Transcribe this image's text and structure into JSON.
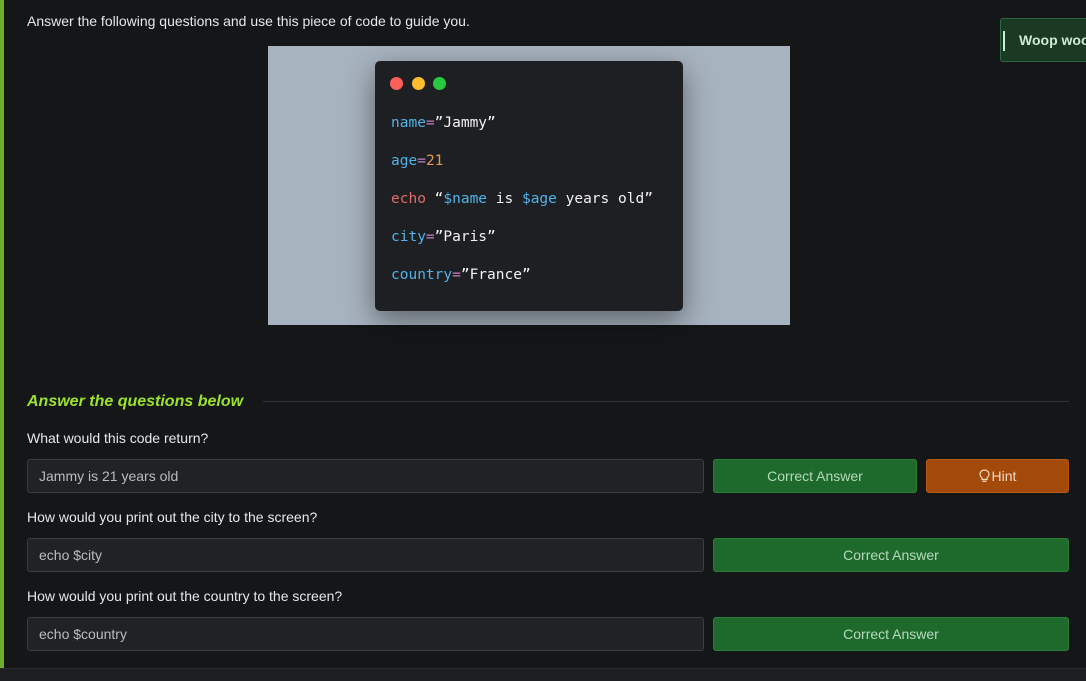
{
  "intro_text": "Answer the following questions and use this piece of code to guide you.",
  "toast": {
    "text": "Woop woop"
  },
  "code_image": {
    "lines": [
      [
        {
          "t": "name",
          "c": "var"
        },
        {
          "t": "=",
          "c": "op"
        },
        {
          "t": "”Jammy”",
          "c": "str"
        }
      ],
      [
        {
          "t": "age",
          "c": "var"
        },
        {
          "t": "=",
          "c": "op"
        },
        {
          "t": "21",
          "c": "num"
        }
      ],
      [
        {
          "t": "echo",
          "c": "cmd"
        },
        {
          "t": " “",
          "c": "str"
        },
        {
          "t": "$name",
          "c": "var"
        },
        {
          "t": " is ",
          "c": "str"
        },
        {
          "t": "$age",
          "c": "var"
        },
        {
          "t": " years old”",
          "c": "str"
        }
      ],
      [
        {
          "t": "city",
          "c": "var"
        },
        {
          "t": "=",
          "c": "op"
        },
        {
          "t": "”Paris”",
          "c": "str"
        }
      ],
      [
        {
          "t": "country",
          "c": "var"
        },
        {
          "t": "=",
          "c": "op"
        },
        {
          "t": "”France”",
          "c": "str"
        }
      ]
    ]
  },
  "section_heading": "Answer the questions below",
  "questions": [
    {
      "text": "What would this code return?",
      "answer": "Jammy is 21 years old",
      "button": "Correct Answer",
      "hint": "Hint"
    },
    {
      "text": "How would you print out the city to the screen?",
      "answer": "echo $city",
      "button": "Correct Answer"
    },
    {
      "text": "How would you print out the country to the screen?",
      "answer": "echo $country",
      "button": "Correct Answer"
    }
  ],
  "colors": {
    "accent_green": "#9be22d",
    "correct_button": "#1e6a2c",
    "hint_button": "#a34a0b"
  }
}
